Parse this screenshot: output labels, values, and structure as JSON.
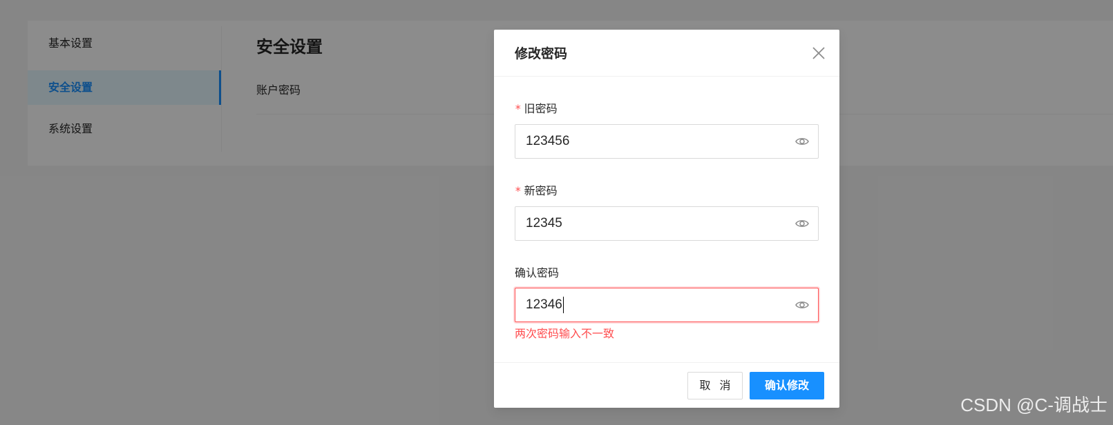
{
  "background": {
    "menu": [
      {
        "label": "基本设置",
        "active": false
      },
      {
        "label": "安全设置",
        "active": true
      },
      {
        "label": "系统设置",
        "active": false
      }
    ],
    "content_title": "安全设置",
    "row_label": "账户密码"
  },
  "modal": {
    "title": "修改密码",
    "close_icon": "close-icon",
    "fields": {
      "old_password": {
        "label": "旧密码",
        "required": true,
        "value": "123456",
        "icon": "eye-icon"
      },
      "new_password": {
        "label": "新密码",
        "required": true,
        "value": "12345",
        "icon": "eye-icon"
      },
      "confirm_password": {
        "label": "确认密码",
        "required": false,
        "value": "12346",
        "icon": "eye-icon",
        "error": "两次密码输入不一致"
      }
    },
    "required_mark": "*",
    "buttons": {
      "cancel": "取 消",
      "ok": "确认修改"
    }
  },
  "watermark": "CSDN @C-调战士",
  "colors": {
    "primary": "#1890ff",
    "error": "#ff4d4f",
    "mask": "rgba(0,0,0,0.45)"
  }
}
